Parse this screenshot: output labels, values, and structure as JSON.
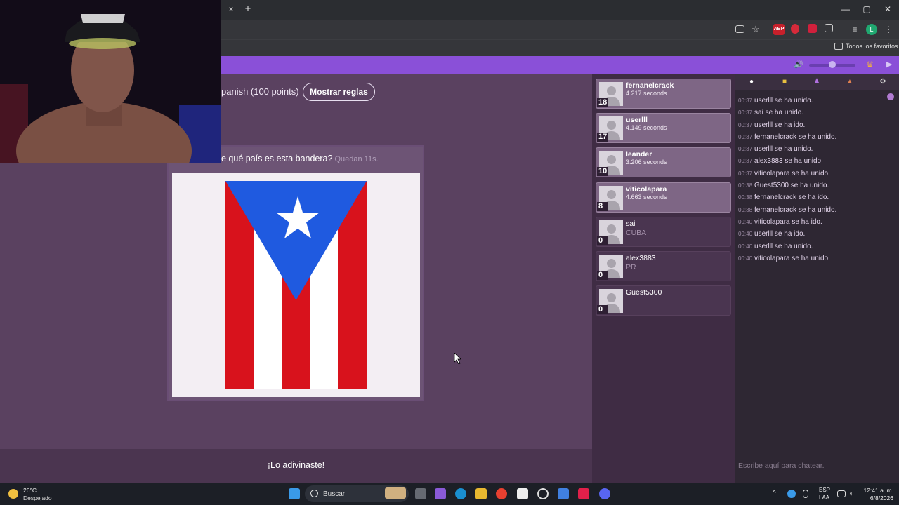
{
  "browser": {
    "tab_close": "×",
    "tab_new": "+",
    "window_controls": [
      "—",
      "▢",
      "✕"
    ],
    "bookmarks_label": "Todos los favoritos"
  },
  "game": {
    "title_partial": "panish (100 points)",
    "rules_button": "Mostrar reglas",
    "question": "e qué país es esta bandera?",
    "time_left": "Quedan 11s.",
    "flag_icon": "puerto-rico-flag",
    "result": "¡Lo adivinaste!"
  },
  "players": [
    {
      "name": "fernanelcrack",
      "detail": "4.217 seconds",
      "score": "18",
      "status": "guessed"
    },
    {
      "name": "userlll",
      "detail": "4.149 seconds",
      "score": "17",
      "status": "guessed"
    },
    {
      "name": "leander",
      "detail": "3.206 seconds",
      "score": "10",
      "status": "guessed"
    },
    {
      "name": "viticolapara",
      "detail": "4.663 seconds",
      "score": "8",
      "status": "guessed"
    },
    {
      "name": "sai",
      "detail": "CUBA",
      "score": "0",
      "status": "pending"
    },
    {
      "name": "alex3883",
      "detail": "PR",
      "score": "0",
      "status": "pending"
    },
    {
      "name": "Guest5300",
      "detail": "",
      "score": "0",
      "status": "pending"
    }
  ],
  "chat": {
    "tabs": [
      "chat-icon",
      "gift-icon",
      "user-icon",
      "fire-icon",
      "gear-icon"
    ],
    "messages": [
      {
        "time": "00:37",
        "text": "userlll se ha unido."
      },
      {
        "time": "00:37",
        "text": "sai se ha unido."
      },
      {
        "time": "00:37",
        "text": "userlll se ha ido."
      },
      {
        "time": "00:37",
        "text": "fernanelcrack se ha unido."
      },
      {
        "time": "00:37",
        "text": "userlll se ha unido."
      },
      {
        "time": "00:37",
        "text": "alex3883 se ha unido."
      },
      {
        "time": "00:37",
        "text": "viticolapara se ha unido."
      },
      {
        "time": "00:38",
        "text": "Guest5300 se ha unido."
      },
      {
        "time": "00:38",
        "text": "fernanelcrack se ha ido."
      },
      {
        "time": "00:38",
        "text": "fernanelcrack se ha unido."
      },
      {
        "time": "00:40",
        "text": "viticolapara se ha ido."
      },
      {
        "time": "00:40",
        "text": "userlll se ha ido."
      },
      {
        "time": "00:40",
        "text": "userlll se ha unido."
      },
      {
        "time": "00:40",
        "text": "viticolapara se ha unido."
      }
    ],
    "input_placeholder": "Escribe aquí para chatear."
  },
  "taskbar": {
    "weather_temp": "26°C",
    "weather_desc": "Despejado",
    "search_label": "Buscar",
    "lang_line1": "ESP",
    "lang_line2": "LAA",
    "time": "12:41 a. m.",
    "date": "6/8/2026"
  },
  "colors": {
    "header": "#8a50d8",
    "game_bg": "#5a4160",
    "flag_red": "#d8121c",
    "flag_blue": "#1f5ae0"
  }
}
